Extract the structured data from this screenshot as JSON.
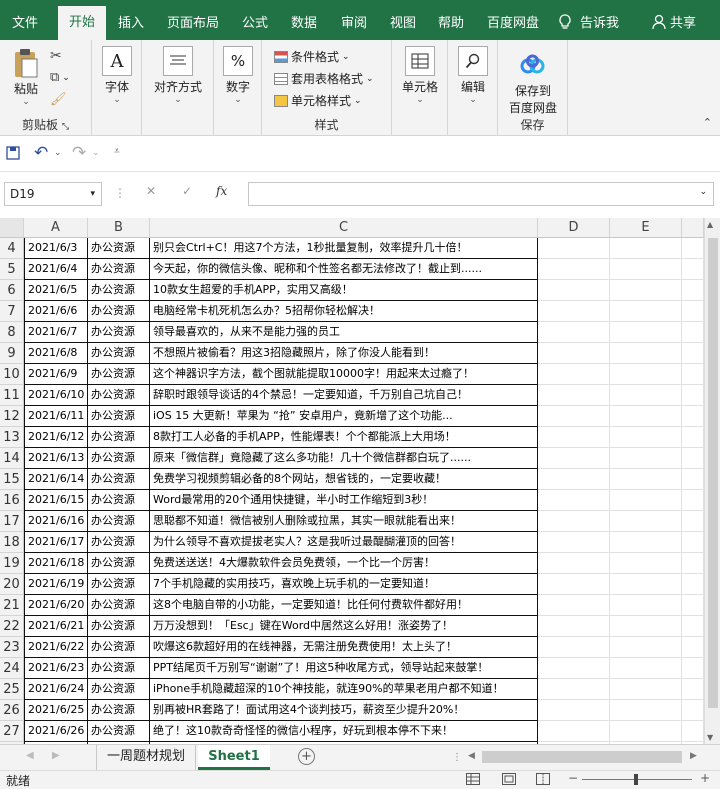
{
  "ribbon_tabs": [
    {
      "label": "文件"
    },
    {
      "label": "开始"
    },
    {
      "label": "插入"
    },
    {
      "label": "页面布局"
    },
    {
      "label": "公式"
    },
    {
      "label": "数据"
    },
    {
      "label": "审阅"
    },
    {
      "label": "视图"
    },
    {
      "label": "帮助"
    },
    {
      "label": "百度网盘"
    },
    {
      "label": "告诉我"
    },
    {
      "label": "共享"
    }
  ],
  "ribbon": {
    "clipboard": {
      "paste": "粘贴",
      "group": "剪贴板"
    },
    "font": {
      "label": "字体",
      "icon_text": "A"
    },
    "align": {
      "label": "对齐方式"
    },
    "number": {
      "label": "数字",
      "icon_text": "%"
    },
    "styles": {
      "cond": "条件格式",
      "table": "套用表格格式",
      "cell": "单元格样式",
      "group": "样式"
    },
    "cells": {
      "label": "单元格"
    },
    "edit": {
      "label": "编辑"
    },
    "save": {
      "line1": "保存到",
      "line2": "百度网盘",
      "group": "保存"
    }
  },
  "formula_bar": {
    "name_box": "D19",
    "fx": "fx",
    "cancel": "✕",
    "enter": "✓",
    "value": ""
  },
  "columns": [
    "A",
    "B",
    "C",
    "D",
    "E"
  ],
  "rows": [
    {
      "num": "4",
      "date": "2021/6/3",
      "cat": "办公资源",
      "title": "别只会Ctrl+C！用这7个方法，1秒批量复制，效率提升几十倍！"
    },
    {
      "num": "5",
      "date": "2021/6/4",
      "cat": "办公资源",
      "title": "今天起，你的微信头像、昵称和个性签名都无法修改了！截止到......"
    },
    {
      "num": "6",
      "date": "2021/6/5",
      "cat": "办公资源",
      "title": "10款女生超爱的手机APP，实用又高级！"
    },
    {
      "num": "7",
      "date": "2021/6/6",
      "cat": "办公资源",
      "title": "电脑经常卡机死机怎么办？5招帮你轻松解决！"
    },
    {
      "num": "8",
      "date": "2021/6/7",
      "cat": "办公资源",
      "title": "领导最喜欢的，从来不是能力强的员工"
    },
    {
      "num": "9",
      "date": "2021/6/8",
      "cat": "办公资源",
      "title": "不想照片被偷看？用这3招隐藏照片，除了你没人能看到！"
    },
    {
      "num": "10",
      "date": "2021/6/9",
      "cat": "办公资源",
      "title": "这个神器识字方法，截个图就能提取10000字！用起来太过瘾了！"
    },
    {
      "num": "11",
      "date": "2021/6/10",
      "cat": "办公资源",
      "title": "辞职时跟领导谈话的4个禁忌！一定要知道，千万别自己坑自己！"
    },
    {
      "num": "12",
      "date": "2021/6/11",
      "cat": "办公资源",
      "title": "iOS 15 大更新！苹果为 “抢” 安卓用户，竟新增了这个功能..."
    },
    {
      "num": "13",
      "date": "2021/6/12",
      "cat": "办公资源",
      "title": "8款打工人必备的手机APP，性能爆表！个个都能派上大用场！"
    },
    {
      "num": "14",
      "date": "2021/6/13",
      "cat": "办公资源",
      "title": "原来「微信群」竟隐藏了这么多功能！几十个微信群都白玩了......"
    },
    {
      "num": "15",
      "date": "2021/6/14",
      "cat": "办公资源",
      "title": "免费学习视频剪辑必备的8个网站，想省钱的，一定要收藏！"
    },
    {
      "num": "16",
      "date": "2021/6/15",
      "cat": "办公资源",
      "title": "Word最常用的20个通用快捷键，半小时工作缩短到3秒！"
    },
    {
      "num": "17",
      "date": "2021/6/16",
      "cat": "办公资源",
      "title": "思聪都不知道！微信被别人删除或拉黑，其实一眼就能看出来！"
    },
    {
      "num": "18",
      "date": "2021/6/17",
      "cat": "办公资源",
      "title": "为什么领导不喜欢提拔老实人？这是我听过最醍醐灌顶的回答！"
    },
    {
      "num": "19",
      "date": "2021/6/18",
      "cat": "办公资源",
      "title": "免费送送送！4大爆款软件会员免费领，一个比一个厉害！"
    },
    {
      "num": "20",
      "date": "2021/6/19",
      "cat": "办公资源",
      "title": "7个手机隐藏的实用技巧，喜欢晚上玩手机的一定要知道！"
    },
    {
      "num": "21",
      "date": "2021/6/20",
      "cat": "办公资源",
      "title": "这8个电脑自带的小功能，一定要知道！比任何付费软件都好用！"
    },
    {
      "num": "22",
      "date": "2021/6/21",
      "cat": "办公资源",
      "title": "万万没想到！「Esc」键在Word中居然这么好用！涨姿势了！"
    },
    {
      "num": "23",
      "date": "2021/6/22",
      "cat": "办公资源",
      "title": "吹爆这6款超好用的在线神器，无需注册免费使用！太上头了！"
    },
    {
      "num": "24",
      "date": "2021/6/23",
      "cat": "办公资源",
      "title": "PPT结尾页千万别写“谢谢”了！用这5种收尾方式，领导站起来鼓掌！"
    },
    {
      "num": "25",
      "date": "2021/6/24",
      "cat": "办公资源",
      "title": "iPhone手机隐藏超深的10个神技能，就连90%的苹果老用户都不知道！"
    },
    {
      "num": "26",
      "date": "2021/6/25",
      "cat": "办公资源",
      "title": "别再被HR套路了！面试用这4个谈判技巧，薪资至少提升20%！"
    },
    {
      "num": "27",
      "date": "2021/6/26",
      "cat": "办公资源",
      "title": "绝了！这10款奇奇怪怪的微信小程序，好玩到根本停不下来！"
    },
    {
      "num": "28",
      "date": "",
      "cat": "",
      "title": ""
    }
  ],
  "sheets": [
    {
      "label": "一周题材规划",
      "active": false
    },
    {
      "label": "Sheet1",
      "active": true
    }
  ],
  "status": {
    "ready": "就绪"
  },
  "colors": {
    "accent": "#217346",
    "sheet_active": "#217346"
  }
}
